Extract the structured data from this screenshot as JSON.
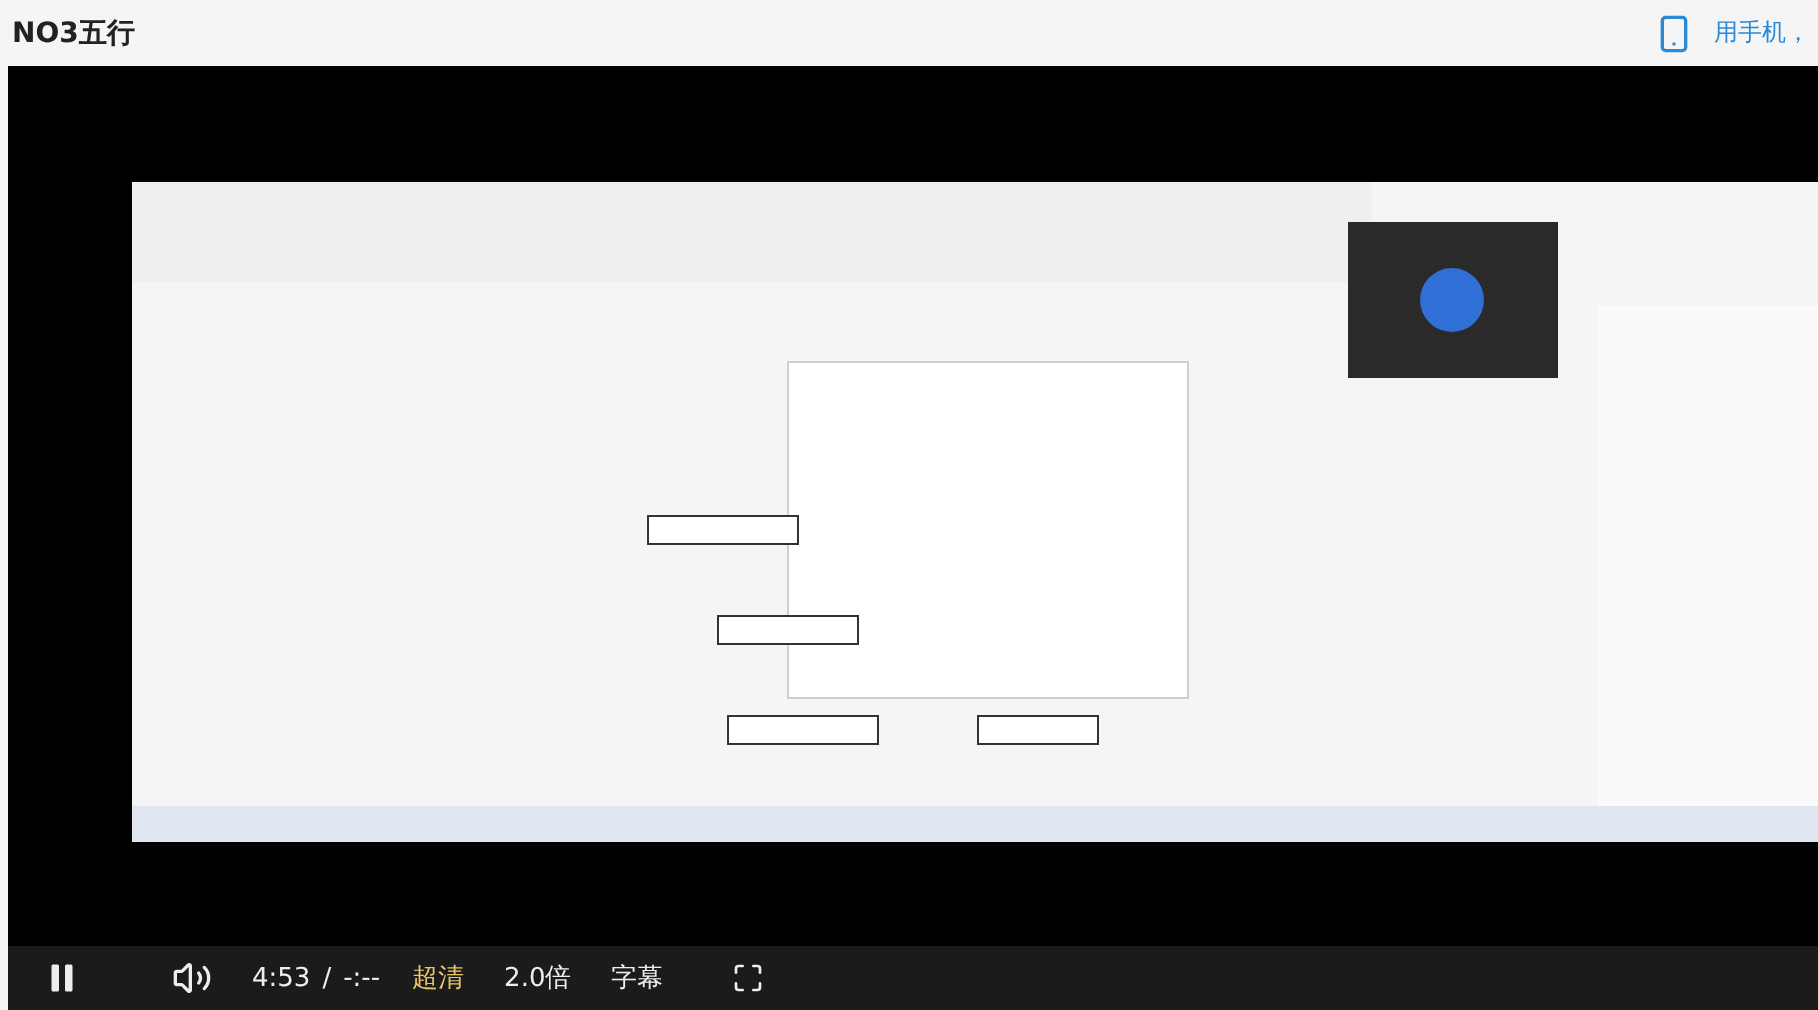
{
  "header": {
    "title": "NO3五行",
    "mobile_link": "用手机，"
  },
  "controls": {
    "playing": true,
    "time": "4:53",
    "separator": "/",
    "duration": "-:--",
    "quality": "超清",
    "speed": "2.0倍",
    "subtitles": "字幕"
  }
}
